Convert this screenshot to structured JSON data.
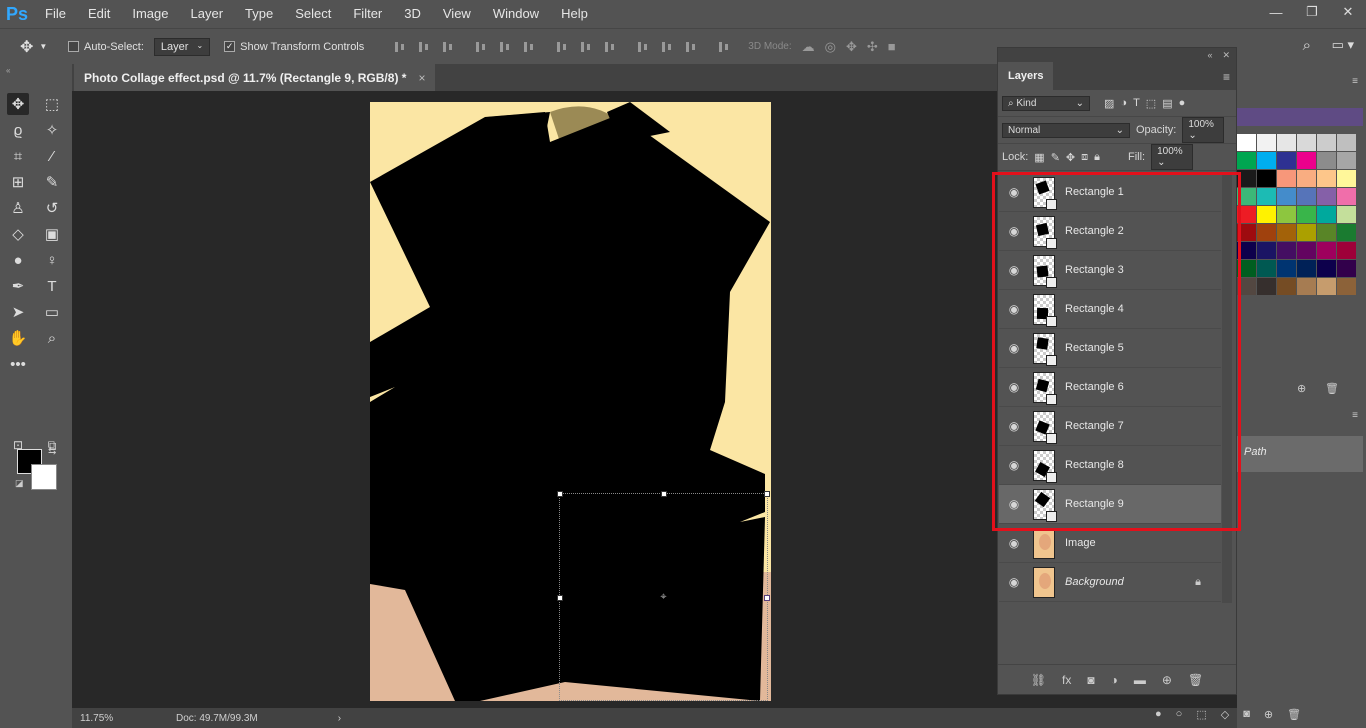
{
  "app": {
    "logo": "Ps"
  },
  "menu": [
    "File",
    "Edit",
    "Image",
    "Layer",
    "Type",
    "Select",
    "Filter",
    "3D",
    "View",
    "Window",
    "Help"
  ],
  "window_controls": [
    "—",
    "❐",
    "✕"
  ],
  "options_bar": {
    "auto_select_label": "Auto-Select:",
    "auto_select_checked": false,
    "auto_select_target": "Layer",
    "show_transform_label": "Show Transform Controls",
    "show_transform_checked": true,
    "mode_3d_label": "3D Mode:"
  },
  "document": {
    "tab_title": "Photo Collage effect.psd @ 11.7% (Rectangle 9, RGB/8) *",
    "close": "×"
  },
  "status": {
    "zoom": "11.75%",
    "doc_info": "Doc: 49.7M/99.3M"
  },
  "layers_panel": {
    "tab": "Layers",
    "filter_kind": "Kind",
    "blend_mode": "Normal",
    "opacity_label": "Opacity:",
    "opacity_value": "100%",
    "lock_label": "Lock:",
    "fill_label": "Fill:",
    "fill_value": "100%",
    "layers": [
      {
        "name": "Rectangle 1",
        "type": "shape",
        "selected": false
      },
      {
        "name": "Rectangle 2",
        "type": "shape",
        "selected": false
      },
      {
        "name": "Rectangle 3",
        "type": "shape",
        "selected": false
      },
      {
        "name": "Rectangle 4",
        "type": "shape",
        "selected": false
      },
      {
        "name": "Rectangle 5",
        "type": "shape",
        "selected": false
      },
      {
        "name": "Rectangle 6",
        "type": "shape",
        "selected": false
      },
      {
        "name": "Rectangle 7",
        "type": "shape",
        "selected": false
      },
      {
        "name": "Rectangle 8",
        "type": "shape",
        "selected": false
      },
      {
        "name": "Rectangle 9",
        "type": "shape",
        "selected": true
      },
      {
        "name": "Image",
        "type": "image",
        "selected": false
      },
      {
        "name": "Background",
        "type": "background",
        "selected": false,
        "locked": true
      }
    ],
    "highlight_color": "#e3101b"
  },
  "paths_panel": {
    "row_label": "Path"
  },
  "swatches": [
    "#ffffff",
    "#f2f2f2",
    "#e6e6e6",
    "#d9d9d9",
    "#cccccc",
    "#bfbfbf",
    "#00a651",
    "#00aeef",
    "#2e3192",
    "#ec008c",
    "#8c8c8c",
    "#a6a6a6",
    "#1a1a1a",
    "#000000",
    "#f7977a",
    "#f9ad81",
    "#fdc68a",
    "#fff79a",
    "#3cb878",
    "#1cbbb4",
    "#448ccb",
    "#5674b9",
    "#8560a8",
    "#f06eaa",
    "#ed1c24",
    "#fff200",
    "#8dc63f",
    "#39b54a",
    "#00a99d",
    "#c4df9b",
    "#9e0b0f",
    "#a0410d",
    "#a36209",
    "#aba000",
    "#598527",
    "#1a7b30",
    "#0d004c",
    "#1b1464",
    "#440e62",
    "#630460",
    "#9e005d",
    "#9e0039",
    "#005e20",
    "#005952",
    "#003471",
    "#002157",
    "#0d004c",
    "#32004b",
    "#534741",
    "#362f2d",
    "#754c24",
    "#a67c52",
    "#c69c6d",
    "#8c6239"
  ],
  "accent_colors": {
    "toolbar_bg": "#535353",
    "canvas_bg": "#282828",
    "canvas_paper": "#fbe6a4"
  }
}
